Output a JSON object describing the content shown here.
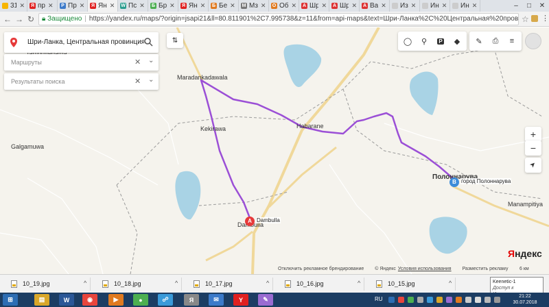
{
  "browser": {
    "tabs": [
      {
        "label": "31",
        "color": "#f7b500",
        "letter": ""
      },
      {
        "label": "пр",
        "color": "#e02020",
        "letter": "Я"
      },
      {
        "label": "Пр",
        "color": "#3c7ac9",
        "letter": "Р"
      },
      {
        "label": "Ян",
        "color": "#e02020",
        "letter": "Я",
        "active": true
      },
      {
        "label": "Пс",
        "color": "#2a9d8f",
        "letter": "W"
      },
      {
        "label": "Бр",
        "color": "#4caf50",
        "letter": "Б"
      },
      {
        "label": "Ян",
        "color": "#e02020",
        "letter": "Я"
      },
      {
        "label": "Бе",
        "color": "#e07a20",
        "letter": "Б"
      },
      {
        "label": "Мз",
        "color": "#777777",
        "letter": "М"
      },
      {
        "label": "Об",
        "color": "#e07a20",
        "letter": "О"
      },
      {
        "label": "Шр",
        "color": "#d33",
        "letter": "A"
      },
      {
        "label": "Шр",
        "color": "#d33",
        "letter": "A"
      },
      {
        "label": "Ва",
        "color": "#d33",
        "letter": "A"
      },
      {
        "label": "Из",
        "color": "#ccc",
        "letter": ""
      },
      {
        "label": "Ин",
        "color": "#ccc",
        "letter": ""
      },
      {
        "label": "Ин",
        "color": "#ccc",
        "letter": ""
      }
    ],
    "close_glyph": "✕",
    "window_controls": {
      "minimize": "–",
      "maximize": "□",
      "close": "✕"
    },
    "nav": {
      "back": "←",
      "forward": "→",
      "reload": "↻"
    },
    "address": {
      "secure_label": "Защищено",
      "url": "https://yandex.ru/maps/?origin=jsapi21&ll=80.811901%2C7.995738&z=11&from=api-maps&text=Шри-Ланка%2C%20Центральная%20провинция%2C%20Damb..."
    }
  },
  "map": {
    "labels": [
      {
        "text": "Tambuttegama"
      },
      {
        "text": "Maradankadawala"
      },
      {
        "text": "Kekirawa"
      },
      {
        "text": "Habarane"
      },
      {
        "text": "Galgamuwa"
      },
      {
        "text": "Полоннарува"
      },
      {
        "text": "Manampitiya"
      },
      {
        "text": "Dambulla"
      }
    ],
    "search": {
      "query": "Шри-Ланка, Центральная провинция, Dami",
      "routes_label": "Маршруты",
      "results_label": "Результаты поиска",
      "clear_glyph": "✕",
      "chevron_glyph": "⌄"
    },
    "markers": {
      "a": {
        "letter": "A",
        "label": "Dambulla",
        "color": "#e63a3a"
      },
      "b": {
        "letter": "B",
        "label": "город Полоннарува",
        "color": "#3d8cd9"
      }
    },
    "controls": {
      "zoom_in": "+",
      "zoom_out": "−",
      "locate": "➤",
      "layers_glyph": "◆",
      "ruler_glyph": "✎",
      "print_glyph": "⎙",
      "menu_glyph": "≡",
      "parking_glyph": "P",
      "traffic_glyph": "◯",
      "panorama_glyph": "⚲"
    },
    "footer": {
      "ad_disable": "Отключить рекламное брендирование",
      "copyright": "© Яндекс",
      "terms": "Условия использования",
      "advertise": "Разместить рекламу",
      "scale": "6 км"
    },
    "logo": {
      "first": "Я",
      "rest": "ндекс"
    },
    "colors": {
      "route": "#9b4fd6",
      "water": "#a9d3e5",
      "road": "#f0d89a",
      "boundary": "#9a9a9a",
      "minor_road": "#ffffff"
    }
  },
  "downloads": {
    "items": [
      {
        "name": "10_19.jpg"
      },
      {
        "name": "10_18.jpg"
      },
      {
        "name": "10_17.jpg"
      },
      {
        "name": "10_16.jpg"
      },
      {
        "name": "10_15.jpg"
      }
    ],
    "chevron_glyph": "^"
  },
  "tooltip": {
    "title": "Keenetic-1",
    "subtitle": "Доступ к Интернету"
  },
  "taskbar": {
    "items": [
      {
        "name": "start",
        "color": "#2d6db3",
        "glyph": "⊞"
      },
      {
        "name": "explorer",
        "color": "#d9a72a",
        "glyph": "▤"
      },
      {
        "name": "word",
        "color": "#2b5797",
        "glyph": "W"
      },
      {
        "name": "chrome",
        "color": "#e8453c",
        "glyph": "◉"
      },
      {
        "name": "media",
        "color": "#e07a20",
        "glyph": "▶"
      },
      {
        "name": "app",
        "color": "#4caf50",
        "glyph": "●"
      },
      {
        "name": "network",
        "color": "#3a9ad9",
        "glyph": "☍"
      },
      {
        "name": "yandex",
        "color": "#888",
        "glyph": "Я"
      },
      {
        "name": "mail",
        "color": "#3c7ac9",
        "glyph": "✉"
      },
      {
        "name": "yabrowser",
        "color": "#e02020",
        "glyph": "Y"
      },
      {
        "name": "paint",
        "color": "#9a6bd1",
        "glyph": "✎"
      }
    ],
    "lang": "RU",
    "time": "21:22",
    "date": "30.07.2018"
  }
}
